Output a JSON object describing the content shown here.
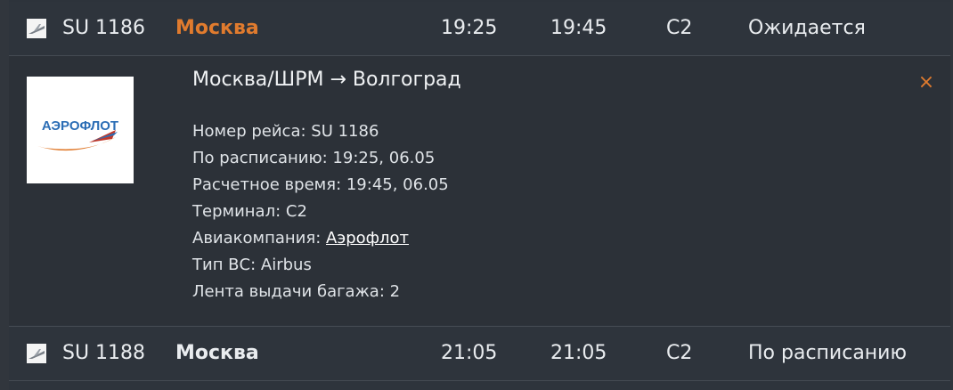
{
  "flights": [
    {
      "number": "SU 1186",
      "city": "Москва",
      "scheduled": "19:25",
      "estimated": "19:45",
      "terminal": "C2",
      "status": "Ожидается"
    },
    {
      "number": "SU 1188",
      "city": "Москва",
      "scheduled": "21:05",
      "estimated": "21:05",
      "terminal": "C2",
      "status": "По расписанию"
    }
  ],
  "detail": {
    "route": "Москва/ШРМ → Волгоград",
    "close_icon": "×",
    "logo_text": "АЭРОФЛОТ",
    "flight_number_label": "Номер рейса: ",
    "flight_number": "SU 1186",
    "scheduled_label": "По расписанию: ",
    "scheduled": "19:25, 06.05",
    "estimated_label": "Расчетное время: ",
    "estimated": "19:45, 06.05",
    "terminal_label": "Терминал: ",
    "terminal": "C2",
    "airline_label": "Авиакомпания: ",
    "airline": "Аэрофлот",
    "aircraft_label": "Тип ВС: ",
    "aircraft": "Airbus",
    "baggage_label": "Лента выдачи багажа: ",
    "baggage": "2"
  },
  "colors": {
    "accent": "#e07b2e",
    "background": "#2d333b"
  },
  "icons": {
    "flight_icon": "plane-icon",
    "close_icon": "close-icon"
  }
}
